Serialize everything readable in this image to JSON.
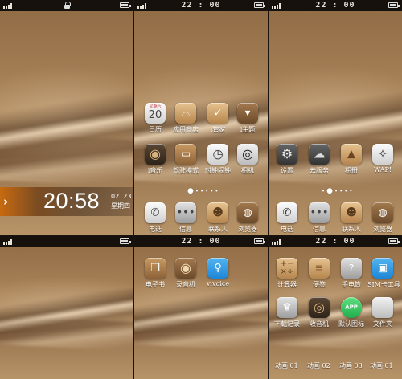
{
  "status": {
    "time": "22 : 00"
  },
  "lockscreen": {
    "time": "20:58",
    "date": "02. 23",
    "weekday": "星期四"
  },
  "home1": {
    "rows": [
      [
        {
          "label": "日历",
          "icon": "calendar-icon",
          "badge_top": "星期六",
          "badge_num": "20"
        },
        {
          "label": "应用商店",
          "icon": "shopping-bag-icon"
        },
        {
          "label": "i管家",
          "icon": "shield-check-icon"
        },
        {
          "label": "i主题",
          "icon": "suit-tie-icon"
        }
      ],
      [
        {
          "label": "i音乐",
          "icon": "music-disc-icon"
        },
        {
          "label": "驾驶模式",
          "icon": "car-icon"
        },
        {
          "label": "时钟闹钟",
          "icon": "clock-icon"
        },
        {
          "label": "相机",
          "icon": "camera-icon"
        }
      ]
    ],
    "dock": [
      {
        "label": "电话",
        "icon": "phone-icon"
      },
      {
        "label": "信息",
        "icon": "message-icon"
      },
      {
        "label": "联系人",
        "icon": "contacts-icon"
      },
      {
        "label": "浏览器",
        "icon": "globe-icon"
      }
    ]
  },
  "home2": {
    "rows": [
      [
        {
          "label": "设置",
          "icon": "settings-icon"
        },
        {
          "label": "云服务",
          "icon": "cloud-icon"
        },
        {
          "label": "相册",
          "icon": "mountain-photo-icon"
        },
        {
          "label": "WAP!",
          "icon": "compass-icon"
        }
      ]
    ],
    "dock": [
      {
        "label": "电话",
        "icon": "phone-icon"
      },
      {
        "label": "信息",
        "icon": "message-icon"
      },
      {
        "label": "联系人",
        "icon": "contacts-icon"
      },
      {
        "label": "浏览器",
        "icon": "globe-icon"
      }
    ]
  },
  "home3": {
    "rows": [
      [
        {
          "label": "电子书",
          "icon": "book-icon"
        },
        {
          "label": "录音机",
          "icon": "recorder-icon"
        },
        {
          "label": "vivoice",
          "icon": "microphone-icon"
        }
      ]
    ]
  },
  "home4": {
    "rows": [
      [
        {
          "label": "计算器",
          "icon": "calculator-icon"
        },
        {
          "label": "便签",
          "icon": "notes-icon"
        },
        {
          "label": "手电筒",
          "icon": "flashlight-icon"
        },
        {
          "label": "SIM卡工具",
          "icon": "sim-card-icon"
        }
      ],
      [
        {
          "label": "下载记录",
          "icon": "crown-download-icon"
        },
        {
          "label": "收音机",
          "icon": "radio-icon"
        },
        {
          "label": "默认图标",
          "icon": "app-icon",
          "text": "APP"
        },
        {
          "label": "文件夹",
          "icon": "folder-icon"
        }
      ]
    ],
    "bottom": [
      "动画 01",
      "动画 02",
      "动画 03",
      "动画 01"
    ]
  }
}
